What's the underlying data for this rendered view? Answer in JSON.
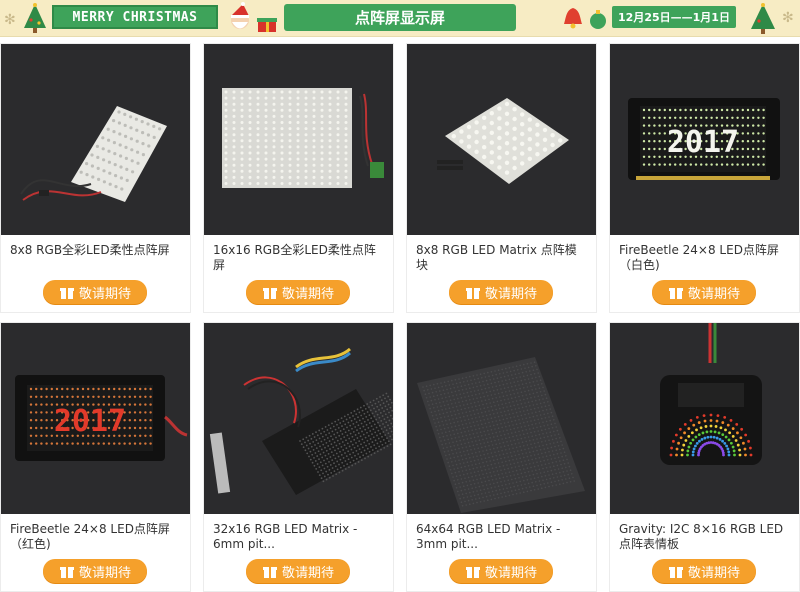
{
  "banner": {
    "christmas": "MERRY CHRISTMAS",
    "title": "点阵屏显示屏",
    "date": "12月25日——1月1日"
  },
  "colors": {
    "banner_bg": "#f7ecc4",
    "green": "#3ea35a",
    "button": "#f5a02b",
    "image_bg": "#2b2b2d"
  },
  "products": [
    {
      "name": "8x8 RGB全彩LED柔性点阵屏",
      "button": "敬请期待",
      "icon": "gift-icon"
    },
    {
      "name": "16x16 RGB全彩LED柔性点阵屏",
      "button": "敬请期待",
      "icon": "gift-icon"
    },
    {
      "name": "8x8 RGB LED Matrix 点阵模块",
      "button": "敬请期待",
      "icon": "gift-icon"
    },
    {
      "name": "FireBeetle 24×8 LED点阵屏（白色)",
      "button": "敬请期待",
      "icon": "gift-icon"
    },
    {
      "name": "FireBeetle 24×8 LED点阵屏（红色)",
      "button": "敬请期待",
      "icon": "gift-icon"
    },
    {
      "name": "32x16 RGB LED Matrix - 6mm pit...",
      "button": "敬请期待",
      "icon": "gift-icon"
    },
    {
      "name": "64x64 RGB LED Matrix - 3mm pit...",
      "button": "敬请期待",
      "icon": "gift-icon"
    },
    {
      "name": "Gravity: I2C 8×16 RGB LED点阵表情板",
      "button": "敬请期待",
      "icon": "gift-icon"
    }
  ],
  "matrix_text": "2017"
}
